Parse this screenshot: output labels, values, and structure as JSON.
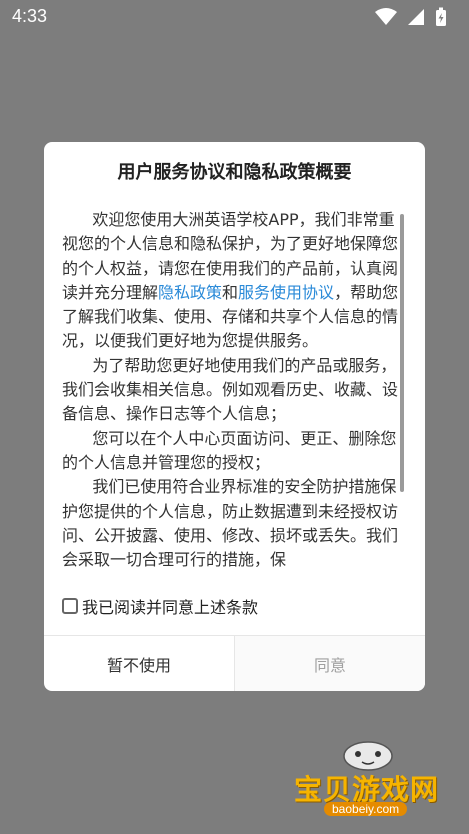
{
  "status_bar": {
    "time": "4:33",
    "icons": [
      "wifi-icon",
      "cellular-signal-icon",
      "battery-charging-icon"
    ]
  },
  "dialog": {
    "title": "用户服务协议和隐私政策概要",
    "body": {
      "p1": {
        "text1": "欢迎您使用大洲英语学校APP，我们非常重视您的个人信息和隐私保护，为了更好地保障您的个人权益，请您在使用我们的产品前，认真阅读并充分理解",
        "link_privacy": "隐私政策",
        "and": "和",
        "link_service": "服务使用协议",
        "text2": "，帮助您了解我们收集、使用、存储和共享个人信息的情况，以便我们更好地为您提供服务。"
      },
      "p2": "为了帮助您更好地使用我们的产品或服务，我们会收集相关信息。例如观看历史、收藏、设备信息、操作日志等个人信息；",
      "p3": "您可以在个人中心页面访问、更正、删除您的个人信息并管理您的授权；",
      "p4": "我们已使用符合业界标准的安全防护措施保护您提供的个人信息，防止数据遭到未经授权访问、公开披露、使用、修改、损坏或丢失。我们会采取一切合理可行的措施，保"
    },
    "agree_label": "我已阅读并同意上述条款",
    "buttons": {
      "cancel": "暂不使用",
      "confirm": "同意"
    }
  },
  "watermark": {
    "text": "宝贝游戏网",
    "url": "baobeiy.com"
  },
  "colors": {
    "overlay": "#7d7d7d",
    "link": "#2a8ad8",
    "watermark": "#f6b400"
  }
}
